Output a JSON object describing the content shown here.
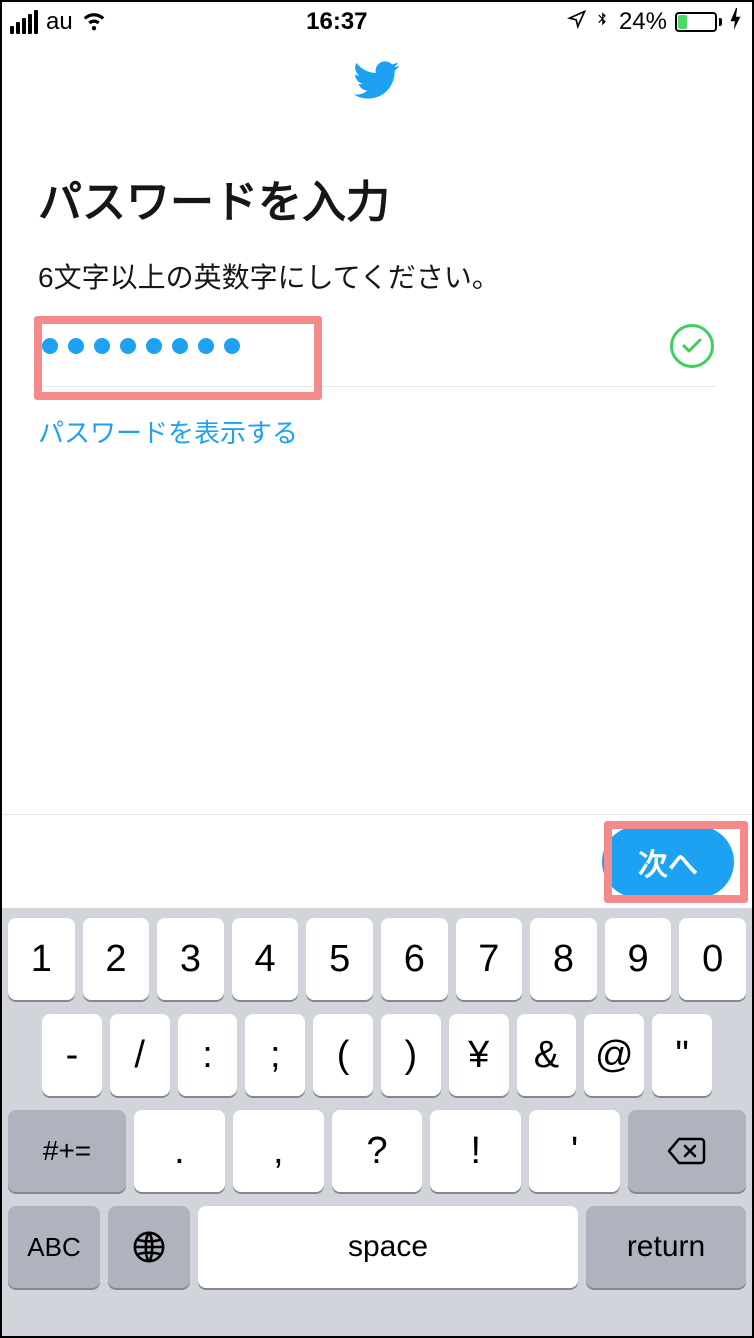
{
  "status": {
    "carrier": "au",
    "time": "16:37",
    "battery_pct": "24%"
  },
  "page": {
    "title": "パスワードを入力",
    "subtitle": "6文字以上の英数字にしてください。",
    "password_dot_count": 8,
    "show_password_label": "パスワードを表示する",
    "next_label": "次へ"
  },
  "keyboard": {
    "row1": [
      "1",
      "2",
      "3",
      "4",
      "5",
      "6",
      "7",
      "8",
      "9",
      "0"
    ],
    "row2": [
      "-",
      "/",
      ":",
      ";",
      "(",
      ")",
      "¥",
      "&",
      "@",
      "\""
    ],
    "row3_mode": "#+=",
    "row3": [
      ".",
      ",",
      "?",
      "!",
      "'"
    ],
    "row4_abc": "ABC",
    "row4_space": "space",
    "row4_return": "return"
  }
}
